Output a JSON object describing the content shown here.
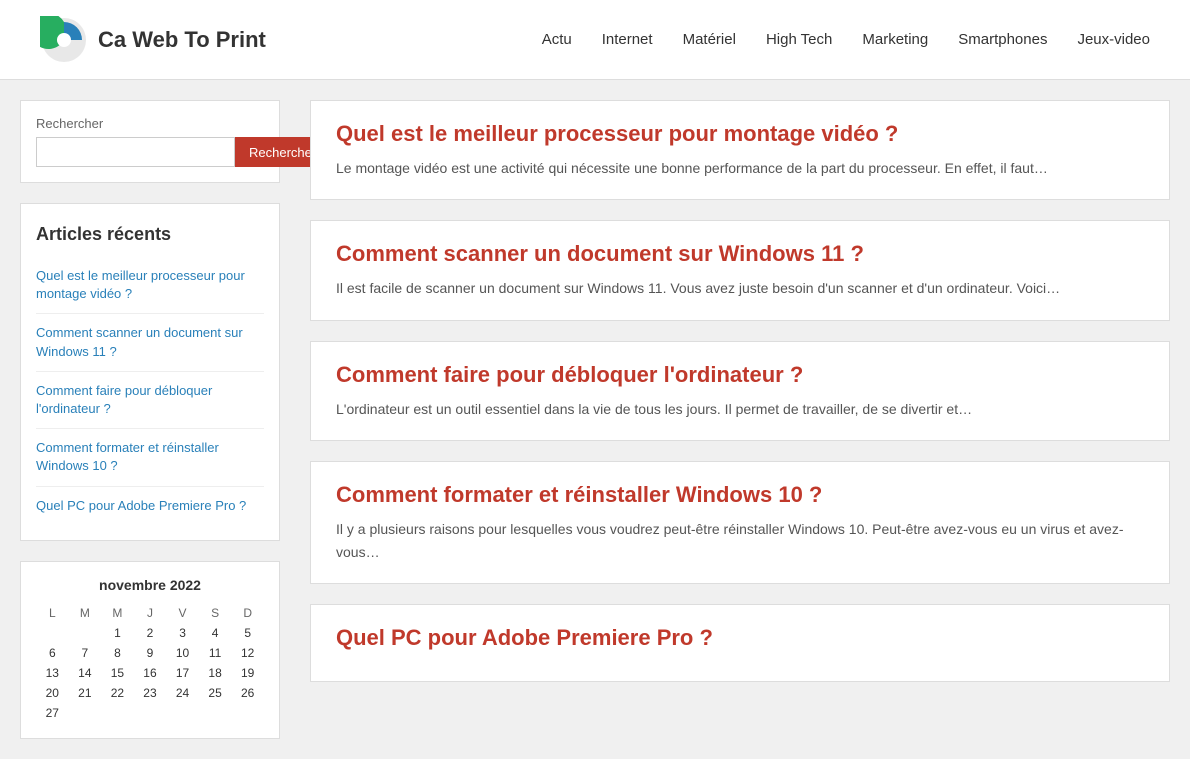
{
  "header": {
    "logo_text": "Ca Web To Print",
    "nav": [
      {
        "label": "Actu",
        "id": "actu"
      },
      {
        "label": "Internet",
        "id": "internet"
      },
      {
        "label": "Matériel",
        "id": "materiel"
      },
      {
        "label": "High Tech",
        "id": "hightech"
      },
      {
        "label": "Marketing",
        "id": "marketing"
      },
      {
        "label": "Smartphones",
        "id": "smartphones"
      },
      {
        "label": "Jeux-video",
        "id": "jeuxvideo"
      }
    ]
  },
  "sidebar": {
    "search": {
      "label": "Rechercher",
      "button_label": "Rechercher",
      "placeholder": ""
    },
    "recent_title": "Articles récents",
    "recent_articles": [
      {
        "title": "Quel est le meilleur processeur pour montage vidéo ?"
      },
      {
        "title": "Comment scanner un document sur Windows 11 ?"
      },
      {
        "title": "Comment faire pour débloquer l'ordinateur ?"
      },
      {
        "title": "Comment formater et réinstaller Windows 10 ?"
      },
      {
        "title": "Quel PC pour Adobe Premiere Pro ?"
      }
    ],
    "calendar": {
      "title": "novembre 2022",
      "days_header": [
        "L",
        "M",
        "M",
        "J",
        "V",
        "S",
        "D"
      ],
      "weeks": [
        [
          "",
          "",
          "1",
          "2",
          "3",
          "4",
          "5"
        ],
        [
          "6",
          "7",
          "8",
          "9",
          "10",
          "11",
          "12"
        ],
        [
          "13",
          "14",
          "15",
          "16",
          "17",
          "18",
          "19"
        ],
        [
          "20",
          "21",
          "22",
          "23",
          "24",
          "25",
          "26"
        ],
        [
          "27",
          "",
          "",
          "",
          "",
          "",
          ""
        ]
      ]
    }
  },
  "articles": [
    {
      "title": "Quel est le meilleur processeur pour montage vidéo ?",
      "excerpt": "Le montage vidéo est une activité qui nécessite une bonne performance de la part du processeur. En effet, il faut…"
    },
    {
      "title": "Comment scanner un document sur Windows 11 ?",
      "excerpt": "Il est facile de scanner un document sur Windows 11. Vous avez juste besoin d'un scanner et d'un ordinateur. Voici…"
    },
    {
      "title": "Comment faire pour débloquer l'ordinateur ?",
      "excerpt": "L'ordinateur est un outil essentiel dans la vie de tous les jours. Il permet de travailler, de se divertir et…"
    },
    {
      "title": "Comment formater et réinstaller Windows 10 ?",
      "excerpt": "Il y a plusieurs raisons pour lesquelles vous voudrez peut-être réinstaller Windows 10. Peut-être avez-vous eu un virus et avez-vous…"
    },
    {
      "title": "Quel PC pour Adobe Premiere Pro ?",
      "excerpt": ""
    }
  ]
}
